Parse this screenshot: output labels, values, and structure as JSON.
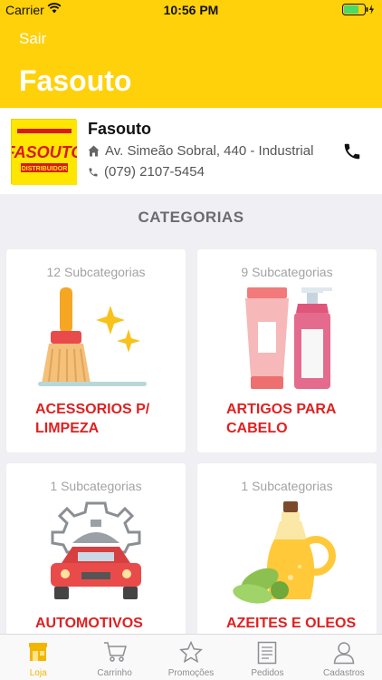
{
  "status_bar": {
    "carrier": "Carrier",
    "time": "10:56 PM"
  },
  "nav": {
    "back_label": "Sair",
    "title": "Fasouto"
  },
  "store": {
    "logo_text_main": "FASOUTO",
    "logo_text_sub": "DISTRIBUIDOR",
    "name": "Fasouto",
    "address": "Av. Simeão Sobral, 440 - Industrial",
    "phone": "(079) 2107-5454"
  },
  "section_title": "CATEGORIAS",
  "categories": [
    {
      "subcount": "12 Subcategorias",
      "label": "ACESSORIOS P/ LIMPEZA",
      "icon": "broom-sparkle-icon"
    },
    {
      "subcount": "9 Subcategorias",
      "label": "ARTIGOS PARA CABELO",
      "icon": "hair-products-icon"
    },
    {
      "subcount": "1 Subcategorias",
      "label": "AUTOMOTIVOS",
      "icon": "car-gear-icon"
    },
    {
      "subcount": "1 Subcategorias",
      "label": "AZEITES E OLEOS",
      "icon": "olive-oil-icon"
    }
  ],
  "tabs": [
    {
      "label": "Loja",
      "icon": "store-icon",
      "active": true
    },
    {
      "label": "Carrinho",
      "icon": "cart-icon",
      "active": false
    },
    {
      "label": "Promoções",
      "icon": "star-icon",
      "active": false
    },
    {
      "label": "Pedidos",
      "icon": "list-icon",
      "active": false
    },
    {
      "label": "Cadastros",
      "icon": "user-icon",
      "active": false
    }
  ],
  "colors": {
    "brand_yellow": "#ffd10a",
    "category_red": "#e02020",
    "active_tab": "#f2b600"
  }
}
